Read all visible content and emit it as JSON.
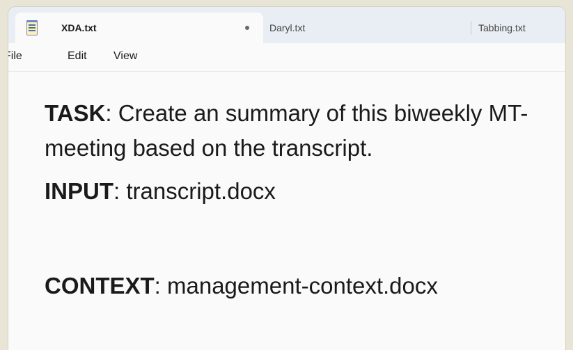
{
  "tabs": [
    {
      "label": "XDA.txt",
      "active": true,
      "modified": true
    },
    {
      "label": "Daryl.txt",
      "active": false
    },
    {
      "label": "Tabbing.txt",
      "active": false
    }
  ],
  "menu": [
    "File",
    "Edit",
    "View"
  ],
  "content": {
    "task_label": "TASK",
    "task_text": ": Create an summary of this biweekly MT-meeting based on the transcript.",
    "input_label": "INPUT",
    "input_text": ": transcript.docx",
    "context_label": "CONTEXT",
    "context_text": ": management-context.docx"
  },
  "colors": {
    "background": "#e9e5d6",
    "tabbar": "#e8eef3",
    "editor": "#fafafa"
  },
  "icons": [
    "notepad-icon",
    "unsaved-dot-icon"
  ]
}
